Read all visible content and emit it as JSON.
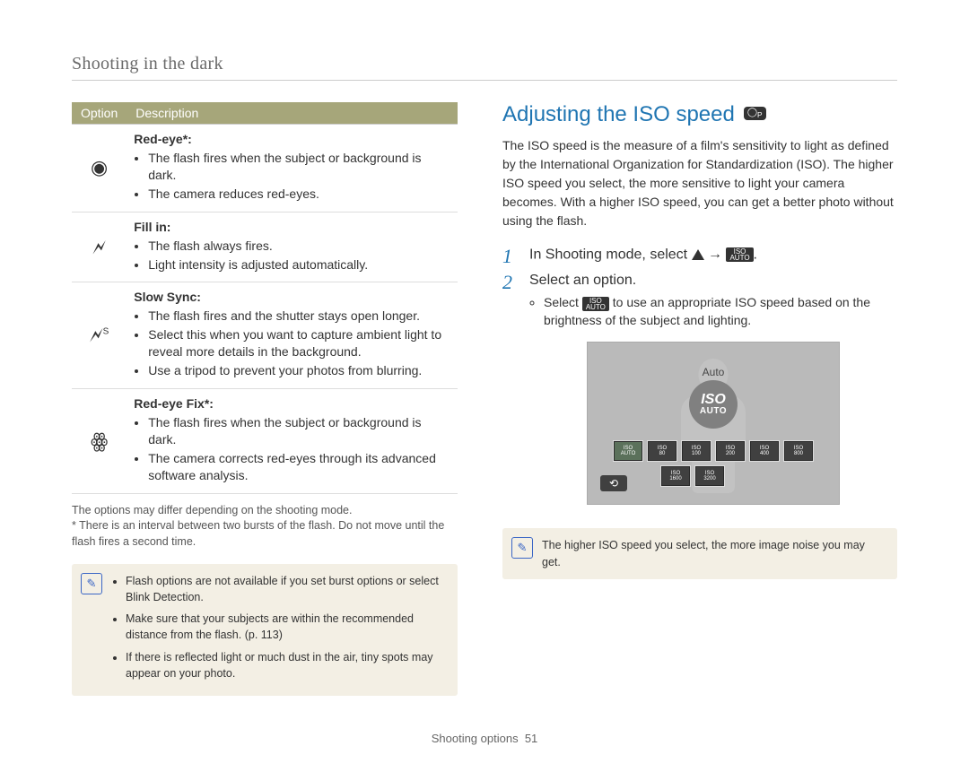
{
  "breadcrumb": "Shooting in the dark",
  "table": {
    "headers": {
      "option": "Option",
      "description": "Description"
    },
    "rows": [
      {
        "title": "Red-eye*:",
        "points": [
          "The flash fires when the subject or background is dark.",
          "The camera reduces red-eyes."
        ]
      },
      {
        "title": "Fill in:",
        "points": [
          "The flash always fires.",
          "Light intensity is adjusted automatically."
        ]
      },
      {
        "title": "Slow Sync:",
        "points": [
          "The flash fires and the shutter stays open longer.",
          "Select this when you want to capture ambient light to reveal more details in the background.",
          "Use a tripod to prevent your photos from blurring."
        ]
      },
      {
        "title": "Red-eye Fix*:",
        "points": [
          "The flash fires when the subject or background is dark.",
          "The camera corrects red-eyes through its advanced software analysis."
        ]
      }
    ]
  },
  "footnotes": [
    "The options may differ depending on the shooting mode.",
    "* There is an interval between two bursts of the flash. Do not move until the flash fires a second time."
  ],
  "leftNote": {
    "points": [
      "Flash options are not available if you set burst options or select Blink Detection.",
      "Make sure that your subjects are within the recommended distance from the flash. (p. 113)",
      "If there is reflected light or much dust in the air, tiny spots may appear on your photo."
    ]
  },
  "section": {
    "title": "Adjusting the ISO speed",
    "body": "The ISO speed is the measure of a film's sensitivity to light as defined by the International Organization for Standardization (ISO). The higher ISO speed you select, the more sensitive to light your camera becomes. With a higher ISO speed, you can get a better photo without using the flash.",
    "steps": {
      "s1": "In Shooting mode, select",
      "s2": "Select an option.",
      "s2_sub_pre": "Select",
      "s2_sub_post": " to use an appropriate ISO speed based on the brightness of the subject and lighting."
    }
  },
  "screen": {
    "autoLabel": "Auto",
    "big": {
      "l1": "ISO",
      "l2": "AUTO"
    },
    "chips_row1": [
      "AUTO",
      "80",
      "100",
      "200",
      "400",
      "800"
    ],
    "chips_row2": [
      "1600",
      "3200"
    ],
    "chipTop": "ISO"
  },
  "rightNote": "The higher ISO speed you select, the more image noise you may get.",
  "footer": {
    "section": "Shooting options",
    "pageNum": "51"
  }
}
